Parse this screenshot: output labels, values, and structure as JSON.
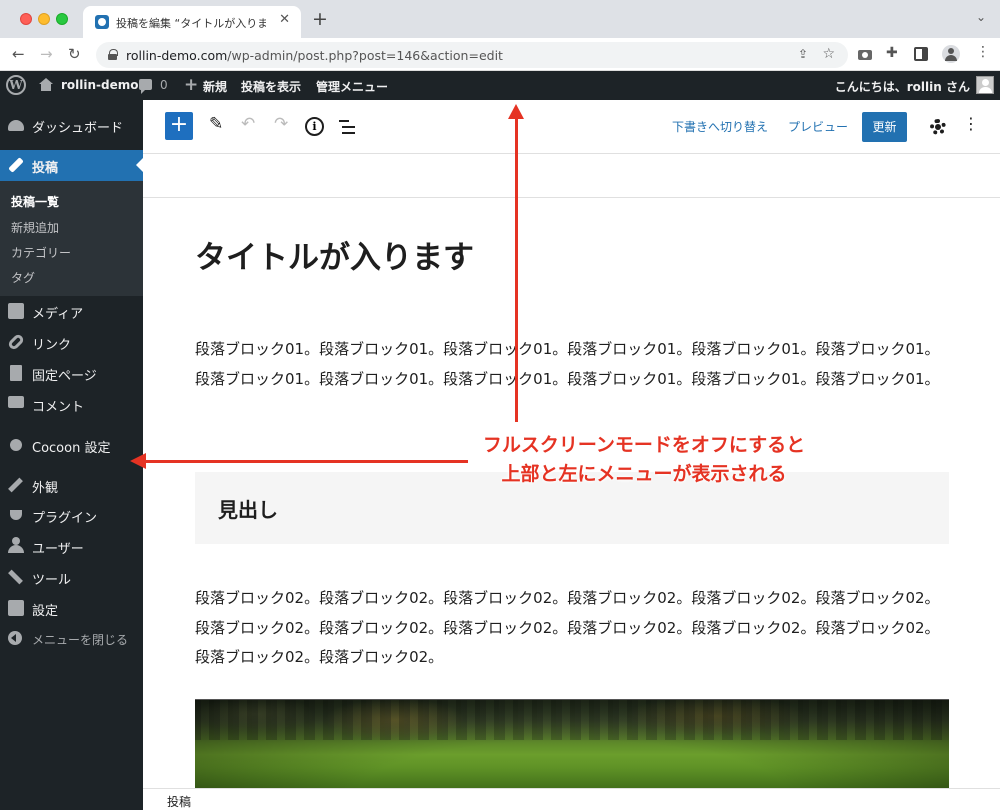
{
  "browser": {
    "tab_title": "投稿を編集 “タイトルが入ります”",
    "url_host": "rollin-demo.com",
    "url_path": "/wp-admin/post.php?post=146&action=edit"
  },
  "admin_bar": {
    "site_name": "rollin-demo",
    "comments_count": "0",
    "new_label": "新規",
    "view_post": "投稿を表示",
    "admin_menu": "管理メニュー",
    "greeting": "こんにちは、rollin さん"
  },
  "sidebar": {
    "dashboard": "ダッシュボード",
    "posts": "投稿",
    "posts_sub": [
      "投稿一覧",
      "新規追加",
      "カテゴリー",
      "タグ"
    ],
    "media": "メディア",
    "links": "リンク",
    "pages": "固定ページ",
    "comments": "コメント",
    "cocoon": "Cocoon 設定",
    "appearance": "外観",
    "plugins": "プラグイン",
    "users": "ユーザー",
    "tools": "ツール",
    "settings": "設定",
    "collapse": "メニューを閉じる"
  },
  "toolbar": {
    "switch_draft": "下書きへ切り替え",
    "preview": "プレビュー",
    "update": "更新"
  },
  "content": {
    "title": "タイトルが入ります",
    "paragraph1": "段落ブロック01。段落ブロック01。段落ブロック01。段落ブロック01。段落ブロック01。段落ブロック01。段落ブロック01。段落ブロック01。段落ブロック01。段落ブロック01。段落ブロック01。段落ブロック01。",
    "heading": "見出し",
    "paragraph2": "段落ブロック02。段落ブロック02。段落ブロック02。段落ブロック02。段落ブロック02。段落ブロック02。段落ブロック02。段落ブロック02。段落ブロック02。段落ブロック02。段落ブロック02。段落ブロック02。段落ブロック02。段落ブロック02。"
  },
  "footer": {
    "breadcrumb": "投稿"
  },
  "annotation": {
    "line1": "フルスクリーンモードをオフにすると",
    "line2": "上部と左にメニューが表示される",
    "color": "#e53323"
  }
}
